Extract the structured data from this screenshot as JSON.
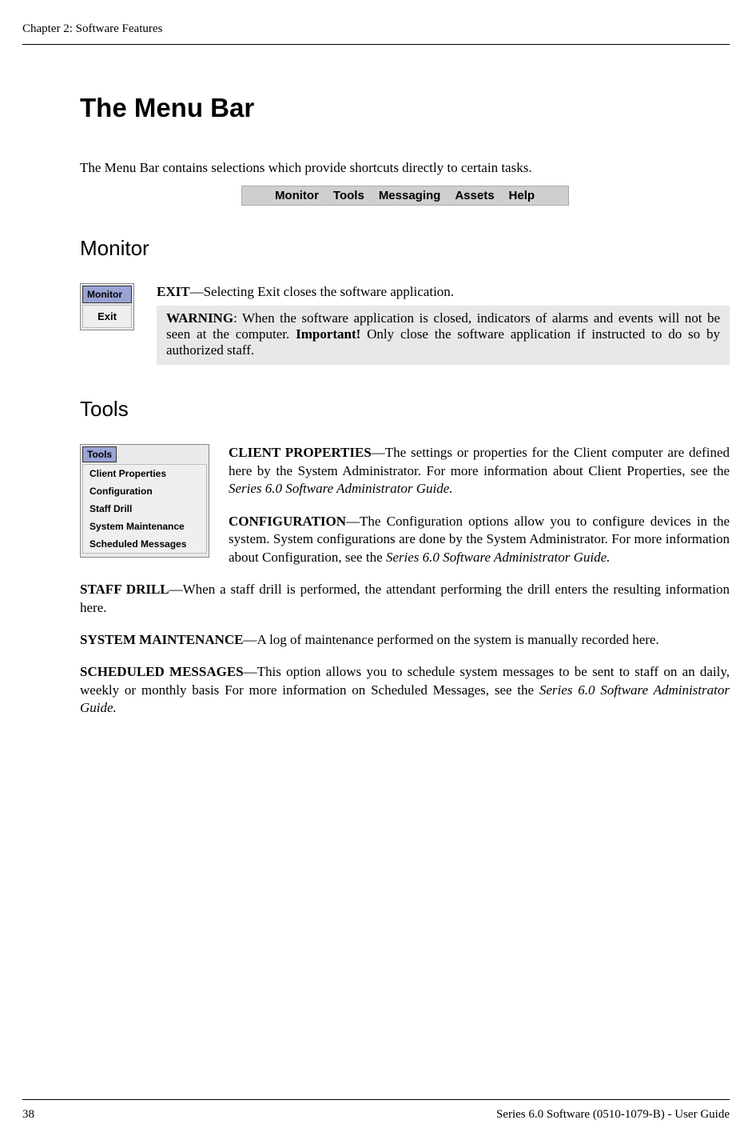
{
  "header": {
    "chapter": "Chapter 2: Software Features"
  },
  "title": "The Menu Bar",
  "intro": "The Menu Bar contains selections which provide shortcuts directly to certain tasks.",
  "menubar": {
    "items": [
      "Monitor",
      "Tools",
      "Messaging",
      "Assets",
      "Help"
    ]
  },
  "monitor": {
    "heading": "Monitor",
    "menu_header": "Monitor",
    "menu_item": "Exit",
    "exit_term": "EXIT",
    "exit_desc": "—Selecting Exit closes the software application.",
    "warning_term": "WARNING",
    "warning_body1": ": When the software application is closed, indicators of alarms and events will not be seen at the computer. ",
    "warning_important": "Important!",
    "warning_body2": " Only close the software application if instructed to do so by authorized staff."
  },
  "tools": {
    "heading": "Tools",
    "menu_header": "Tools",
    "items": [
      "Client Properties",
      "Configuration",
      "Staff Drill",
      "System Maintenance",
      "Scheduled Messages"
    ],
    "client_term": "CLIENT PROPERTIES",
    "client_body1": "—The settings or properties for the Client computer are defined here by the System Administrator. For more information about Client Properties, see the ",
    "client_ref": "Series 6.0 Software Administrator Guide.",
    "config_term": "CONFIGURATION",
    "config_body1": "—The Configuration options allow you to configure devices in the system. System configurations are done by the System Administrator. For more information about Configuration, see the ",
    "config_ref": "Series 6.0 Software Administrator Guide.",
    "staff_term": "STAFF DRILL",
    "staff_body": "—When a staff drill is performed, the attendant performing the drill enters the resulting information here.",
    "sysmaint_term": "SYSTEM MAINTENANCE",
    "sysmaint_body": "—A log of maintenance performed on the system is manually recorded here.",
    "sched_term": "SCHEDULED MESSAGES",
    "sched_body1": "—This option allows you to schedule system messages to be sent to staff on an daily, weekly or monthly basis For more information on Scheduled Messages, see the ",
    "sched_ref": "Series 6.0 Software Administrator Guide."
  },
  "footer": {
    "page_number": "38",
    "right": "Series 6.0 Software (0510-1079-B) - User Guide"
  }
}
